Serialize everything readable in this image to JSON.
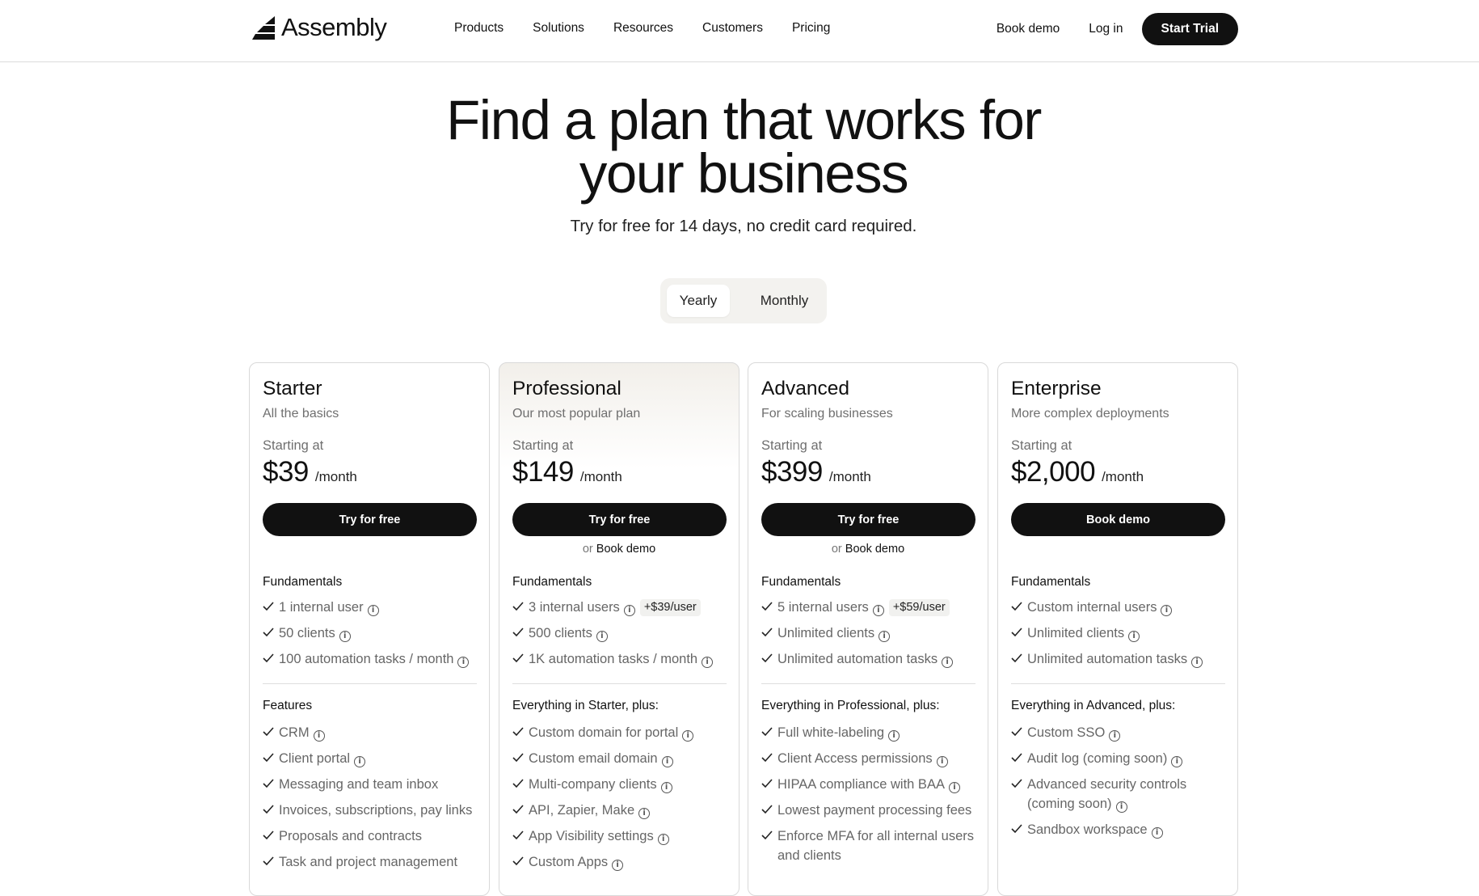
{
  "nav": {
    "logo_text": "Assembly",
    "links": [
      "Products",
      "Solutions",
      "Resources",
      "Customers",
      "Pricing"
    ],
    "book_demo": "Book demo",
    "login": "Log in",
    "start_trial": "Start Trial"
  },
  "hero": {
    "title_line1": "Find a plan that works for",
    "title_line2": "your business",
    "subtitle": "Try for free for 14 days, no credit card required."
  },
  "billing_toggle": {
    "options": [
      "Yearly",
      "Monthly"
    ],
    "selected": "Yearly"
  },
  "plans": [
    {
      "name": "Starter",
      "tagline": "All the basics",
      "starting_label": "Starting at",
      "price": "$39",
      "period": "/month",
      "cta": "Try for free",
      "secondary": null,
      "section1_title": "Fundamentals",
      "fundamentals": [
        {
          "text": "1 internal user",
          "info": true,
          "badge": ""
        },
        {
          "text": "50 clients",
          "info": true,
          "badge": ""
        },
        {
          "text": "100 automation tasks / month",
          "info": true,
          "badge": ""
        }
      ],
      "section2_title": "Features",
      "features": [
        {
          "text": "CRM",
          "info": true
        },
        {
          "text": "Client portal",
          "info": true
        },
        {
          "text": "Messaging and team inbox",
          "info": false
        },
        {
          "text": "Invoices, subscriptions, pay links",
          "info": false
        },
        {
          "text": "Proposals and contracts",
          "info": false
        },
        {
          "text": "Task and project management",
          "info": false
        }
      ]
    },
    {
      "name": "Professional",
      "tagline": "Our most popular plan",
      "starting_label": "Starting at",
      "price": "$149",
      "period": "/month",
      "cta": "Try for free",
      "secondary": {
        "or": "or",
        "link": "Book demo"
      },
      "section1_title": "Fundamentals",
      "fundamentals": [
        {
          "text": "3 internal users",
          "info": true,
          "badge": "+$39/user"
        },
        {
          "text": "500 clients",
          "info": true,
          "badge": ""
        },
        {
          "text": "1K automation tasks / month",
          "info": true,
          "badge": ""
        }
      ],
      "section2_title": "Everything in Starter, plus:",
      "features": [
        {
          "text": "Custom domain for portal",
          "info": true
        },
        {
          "text": "Custom email domain",
          "info": true
        },
        {
          "text": "Multi-company clients",
          "info": true
        },
        {
          "text": "API, Zapier, Make",
          "info": true
        },
        {
          "text": "App Visibility settings",
          "info": true
        },
        {
          "text": "Custom Apps",
          "info": true
        }
      ]
    },
    {
      "name": "Advanced",
      "tagline": "For scaling businesses",
      "starting_label": "Starting at",
      "price": "$399",
      "period": "/month",
      "cta": "Try for free",
      "secondary": {
        "or": "or",
        "link": "Book demo"
      },
      "section1_title": "Fundamentals",
      "fundamentals": [
        {
          "text": "5 internal users",
          "info": true,
          "badge": "+$59/user"
        },
        {
          "text": "Unlimited clients",
          "info": true,
          "badge": ""
        },
        {
          "text": "Unlimited automation tasks",
          "info": true,
          "badge": ""
        }
      ],
      "section2_title": "Everything in Professional, plus:",
      "features": [
        {
          "text": "Full white-labeling",
          "info": true
        },
        {
          "text": "Client Access permissions",
          "info": true
        },
        {
          "text": "HIPAA compliance with BAA",
          "info": true
        },
        {
          "text": "Lowest payment processing fees",
          "info": false
        },
        {
          "text": "Enforce MFA for all internal users and clients",
          "info": false
        }
      ]
    },
    {
      "name": "Enterprise",
      "tagline": "More complex deployments",
      "starting_label": "Starting at",
      "price": "$2,000",
      "period": "/month",
      "cta": "Book demo",
      "secondary": null,
      "section1_title": "Fundamentals",
      "fundamentals": [
        {
          "text": "Custom internal users",
          "info": true,
          "badge": ""
        },
        {
          "text": "Unlimited clients",
          "info": true,
          "badge": ""
        },
        {
          "text": "Unlimited automation tasks",
          "info": true,
          "badge": ""
        }
      ],
      "section2_title": "Everything in Advanced, plus:",
      "features": [
        {
          "text": "Custom SSO",
          "info": true
        },
        {
          "text": "Audit log (coming soon)",
          "info": true
        },
        {
          "text": "Advanced security controls (coming soon)",
          "info": true
        },
        {
          "text": "Sandbox workspace",
          "info": true
        }
      ]
    }
  ],
  "icons": {
    "logo": "assembly-logo-icon",
    "check": "check-icon",
    "info": "info-icon"
  },
  "colors": {
    "primary": "#111111",
    "muted_text": "#6f6f6f",
    "border": "#d9d9d9",
    "toggle_bg": "#f3f2ef"
  }
}
